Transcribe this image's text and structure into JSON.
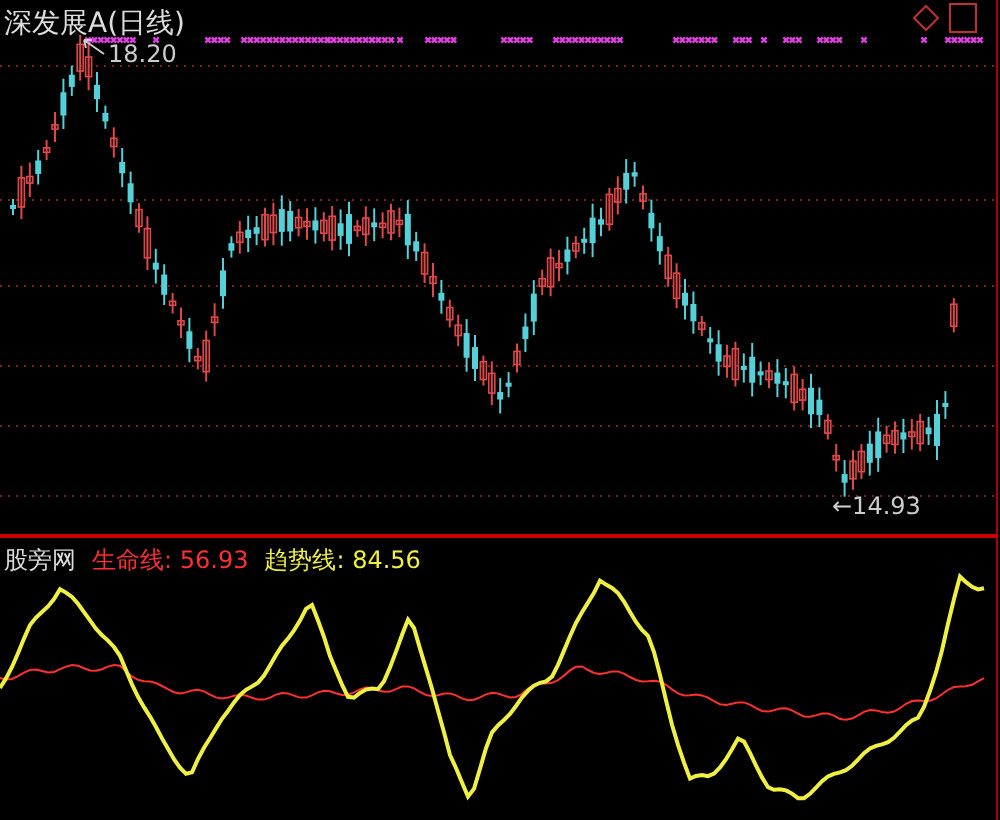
{
  "chart": {
    "title": "深发展A(日线)",
    "high_label": "18.20",
    "low_label": "←14.93"
  },
  "indicator": {
    "name": "股旁网",
    "lines": [
      {
        "label": "生命线:",
        "value": "56.93",
        "color": "#ff3030"
      },
      {
        "label": "趋势线:",
        "value": "84.56",
        "color": "#f0f040"
      }
    ]
  }
}
